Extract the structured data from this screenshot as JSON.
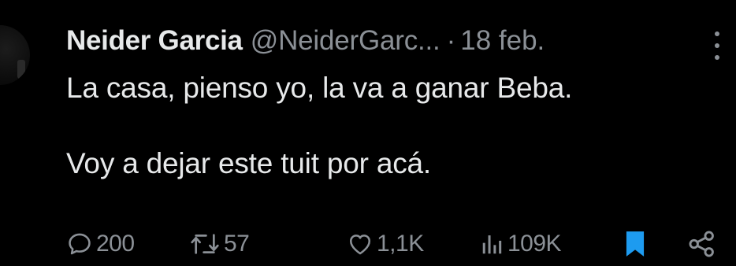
{
  "tweet": {
    "author_name": "Neider Garcia",
    "handle": "@NeiderGarc...",
    "separator": "·",
    "date": "18 feb.",
    "text_line_1": "La casa, pienso yo, la va a ganar Beba.",
    "text_line_2": "Voy a dejar este tuit por acá."
  },
  "metrics": {
    "replies": "200",
    "retweets": "57",
    "likes": "1,1K",
    "views": "109K"
  },
  "icons": {
    "reply": "reply-icon",
    "retweet": "retweet-icon",
    "like": "heart-icon",
    "views": "views-icon",
    "bookmark": "bookmark-icon",
    "share": "share-icon",
    "more": "more-vertical-icon"
  },
  "colors": {
    "background": "#000000",
    "text": "#e7e9ea",
    "muted": "#8b9096",
    "bookmark": "#1d9bf0"
  }
}
